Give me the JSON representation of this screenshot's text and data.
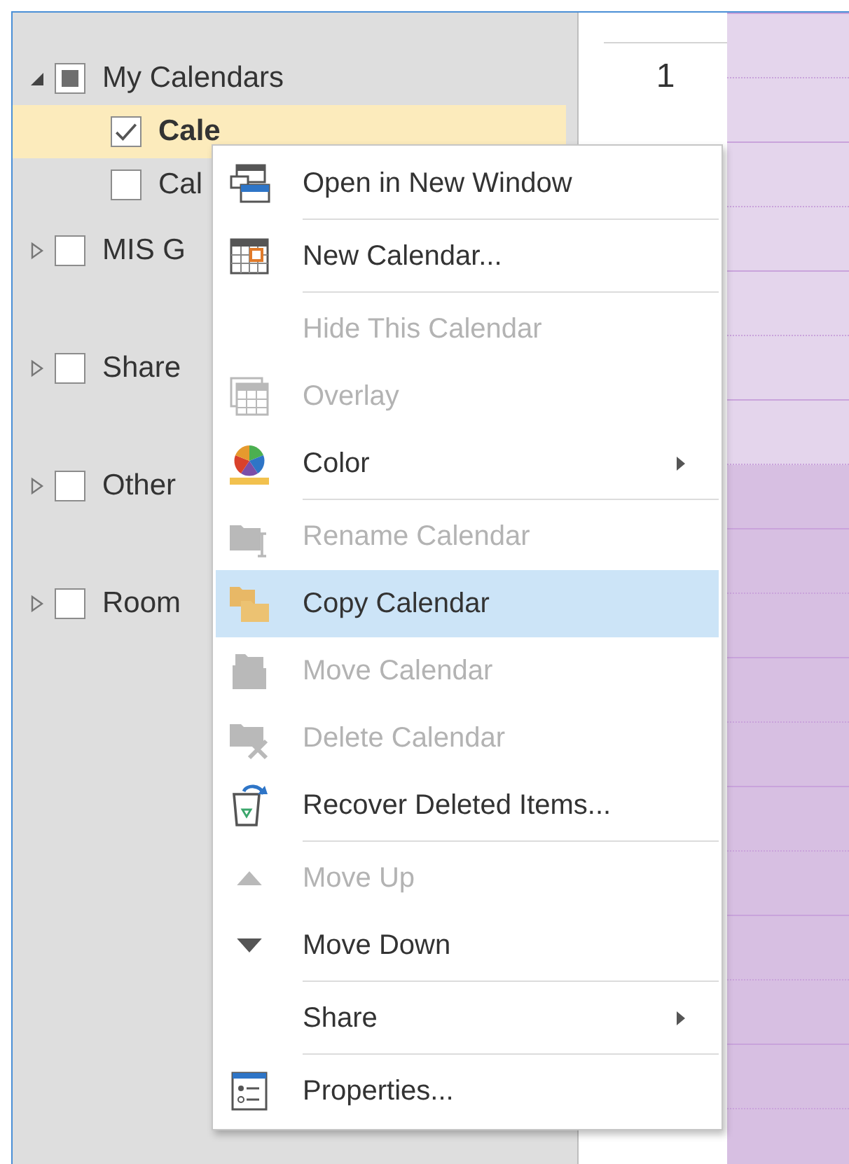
{
  "folder_pane": {
    "groups": [
      {
        "label": "My Calendars",
        "expanded": true,
        "checked": false,
        "indeterminate": true,
        "children": [
          {
            "label": "Cale",
            "checked": true,
            "selected": true
          },
          {
            "label": "Cal",
            "checked": false,
            "selected": false
          }
        ]
      },
      {
        "label": "MIS G",
        "expanded": false,
        "checked": false,
        "indeterminate": false
      },
      {
        "label": "Share",
        "expanded": false,
        "checked": false,
        "indeterminate": false
      },
      {
        "label": "Other",
        "expanded": false,
        "checked": false,
        "indeterminate": false
      },
      {
        "label": "Room",
        "expanded": false,
        "checked": false,
        "indeterminate": false
      }
    ]
  },
  "calendar": {
    "day_number": "1",
    "slots": [
      {
        "kind": "work"
      },
      {
        "kind": "work"
      },
      {
        "kind": "work"
      },
      {
        "kind": "work"
      },
      {
        "kind": "work"
      },
      {
        "kind": "work"
      },
      {
        "kind": "work"
      },
      {
        "kind": "off"
      },
      {
        "kind": "off"
      },
      {
        "kind": "off"
      },
      {
        "kind": "off"
      },
      {
        "kind": "off"
      },
      {
        "kind": "off"
      },
      {
        "kind": "off"
      },
      {
        "kind": "off"
      },
      {
        "kind": "off"
      },
      {
        "kind": "off"
      },
      {
        "kind": "off"
      }
    ]
  },
  "context_menu": {
    "items": [
      {
        "label": "Open in New Window",
        "kind": "windows",
        "disabled": false,
        "selected": false,
        "submenu": false,
        "separator_after": true
      },
      {
        "label": "New Calendar...",
        "kind": "calendar",
        "disabled": false,
        "selected": false,
        "submenu": false,
        "separator_after": true
      },
      {
        "label": "Hide This Calendar",
        "kind": "plain",
        "disabled": true,
        "selected": false,
        "submenu": false,
        "separator_after": false
      },
      {
        "label": "Overlay",
        "kind": "overlay",
        "disabled": true,
        "selected": false,
        "submenu": false,
        "separator_after": false
      },
      {
        "label": "Color",
        "kind": "color",
        "disabled": false,
        "selected": false,
        "submenu": true,
        "separator_after": true
      },
      {
        "label": "Rename Calendar",
        "kind": "rename",
        "disabled": true,
        "selected": false,
        "submenu": false,
        "separator_after": false
      },
      {
        "label": "Copy Calendar",
        "kind": "copy",
        "disabled": false,
        "selected": true,
        "submenu": false,
        "separator_after": false
      },
      {
        "label": "Move Calendar",
        "kind": "move",
        "disabled": true,
        "selected": false,
        "submenu": false,
        "separator_after": false
      },
      {
        "label": "Delete Calendar",
        "kind": "delete",
        "disabled": true,
        "selected": false,
        "submenu": false,
        "separator_after": false
      },
      {
        "label": "Recover Deleted Items...",
        "kind": "recover",
        "disabled": false,
        "selected": false,
        "submenu": false,
        "separator_after": true
      },
      {
        "label": "Move Up",
        "kind": "up",
        "disabled": true,
        "selected": false,
        "submenu": false,
        "separator_after": false
      },
      {
        "label": "Move Down",
        "kind": "down",
        "disabled": false,
        "selected": false,
        "submenu": false,
        "separator_after": true
      },
      {
        "label": "Share",
        "kind": "plain",
        "disabled": false,
        "selected": false,
        "submenu": true,
        "separator_after": true
      },
      {
        "label": "Properties...",
        "kind": "properties",
        "disabled": false,
        "selected": false,
        "submenu": false,
        "separator_after": false
      }
    ]
  }
}
